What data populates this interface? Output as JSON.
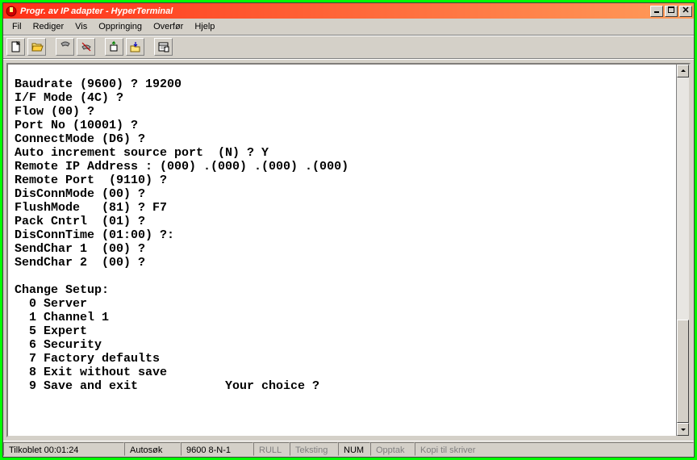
{
  "window": {
    "title": "Progr. av IP adapter - HyperTerminal"
  },
  "menu": {
    "fil": "Fil",
    "rediger": "Rediger",
    "vis": "Vis",
    "oppringing": "Oppringing",
    "overfor": "Overfør",
    "hjelp": "Hjelp"
  },
  "toolbar_icons": {
    "new": "new-file-icon",
    "open": "open-folder-icon",
    "connect": "phone-icon",
    "disconnect": "phone-down-icon",
    "send": "send-icon",
    "receive": "receive-icon",
    "properties": "properties-icon"
  },
  "terminal": {
    "lines": [
      "Baudrate (9600) ? 19200",
      "I/F Mode (4C) ?",
      "Flow (00) ?",
      "Port No (10001) ?",
      "ConnectMode (D6) ?",
      "Auto increment source port  (N) ? Y",
      "Remote IP Address : (000) .(000) .(000) .(000)",
      "Remote Port  (9110) ?",
      "DisConnMode (00) ?",
      "FlushMode   (81) ? F7",
      "Pack Cntrl  (01) ?",
      "DisConnTime (01:00) ?:",
      "SendChar 1  (00) ?",
      "SendChar 2  (00) ?",
      "",
      "Change Setup:",
      "  0 Server",
      "  1 Channel 1",
      "  5 Expert",
      "  6 Security",
      "  7 Factory defaults",
      "  8 Exit without save",
      "  9 Save and exit            Your choice ?"
    ]
  },
  "status": {
    "connected": "Tilkoblet 00:01:24",
    "autodetect": "Autosøk",
    "settings": "9600 8-N-1",
    "scroll": "RULL",
    "caps": "Teksting",
    "num": "NUM",
    "capture": "Opptak",
    "print": "Kopi til skriver"
  }
}
